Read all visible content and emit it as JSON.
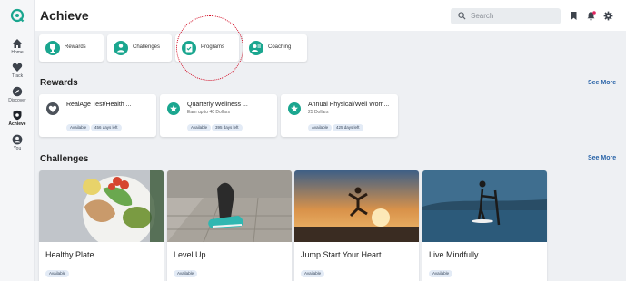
{
  "sidebar": {
    "items": [
      {
        "label": "Home",
        "icon": "home-icon"
      },
      {
        "label": "Track",
        "icon": "heart-icon"
      },
      {
        "label": "Discover",
        "icon": "compass-icon"
      },
      {
        "label": "Achieve",
        "icon": "shield-icon"
      },
      {
        "label": "You",
        "icon": "user-icon"
      }
    ]
  },
  "header": {
    "title": "Achieve",
    "search_placeholder": "Search"
  },
  "quick_links": [
    "Rewards",
    "Challenges",
    "Programs",
    "Coaching"
  ],
  "rewards": {
    "title": "Rewards",
    "see_more": "See More",
    "items": [
      {
        "name": "RealAge Test/Health ...",
        "sub": "",
        "status": "Available",
        "days": "456 days left"
      },
      {
        "name": "Quarterly Wellness ...",
        "sub": "Earn up to 40 Dollars",
        "status": "Available",
        "days": "395 days left"
      },
      {
        "name": "Annual Physical/Well Wom...",
        "sub": "25 Dollars",
        "status": "Available",
        "days": "425 days left"
      }
    ]
  },
  "challenges": {
    "title": "Challenges",
    "see_more": "See More",
    "items": [
      {
        "title": "Healthy Plate",
        "status": "Available"
      },
      {
        "title": "Level Up",
        "status": "Available"
      },
      {
        "title": "Jump Start Your Heart",
        "status": "Available"
      },
      {
        "title": "Live Mindfully",
        "status": "Available"
      }
    ]
  },
  "colors": {
    "accent": "#1aa68f",
    "link": "#2a64a8",
    "annotation": "#d0021b",
    "notification": "#e0245e"
  }
}
